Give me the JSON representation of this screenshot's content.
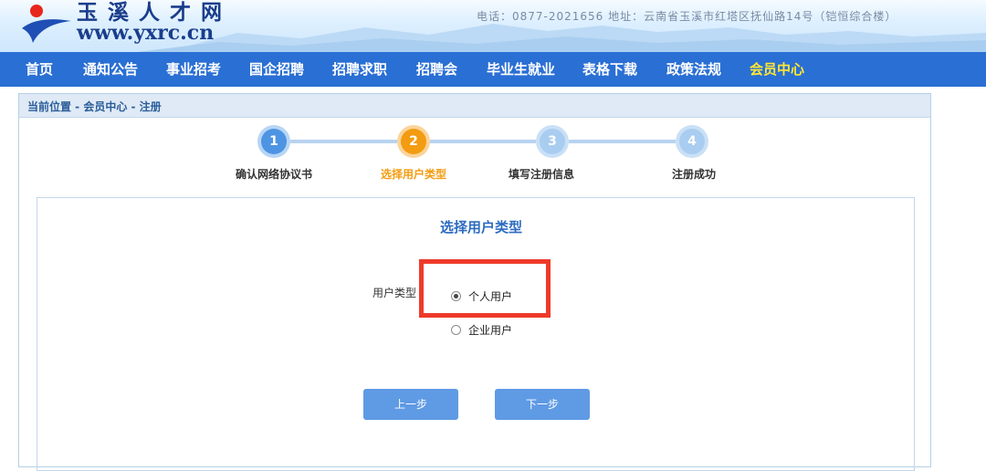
{
  "header": {
    "site_name": "玉溪人才网",
    "site_url": "www.yxrc.cn",
    "contact": "电话：0877-2021656  地址：云南省玉溪市红塔区抚仙路14号（铠恒综合楼）"
  },
  "nav": {
    "items": [
      {
        "label": "首页"
      },
      {
        "label": "通知公告"
      },
      {
        "label": "事业招考"
      },
      {
        "label": "国企招聘"
      },
      {
        "label": "招聘求职"
      },
      {
        "label": "招聘会"
      },
      {
        "label": "毕业生就业"
      },
      {
        "label": "表格下载"
      },
      {
        "label": "政策法规"
      },
      {
        "label": "会员中心"
      }
    ],
    "active": "会员中心"
  },
  "breadcrumb": "当前位置 - 会员中心 - 注册",
  "steps": [
    {
      "number": "1",
      "label": "确认网络协议书",
      "state": "done"
    },
    {
      "number": "2",
      "label": "选择用户类型",
      "state": "current"
    },
    {
      "number": "3",
      "label": "填写注册信息",
      "state": "todo"
    },
    {
      "number": "4",
      "label": "注册成功",
      "state": "todo"
    }
  ],
  "form": {
    "title": "选择用户类型",
    "field_label": "用户类型",
    "options": [
      {
        "label": "个人用户",
        "selected": true
      },
      {
        "label": "企业用户",
        "selected": false
      }
    ],
    "prev_button": "上一步",
    "next_button": "下一步"
  },
  "colors": {
    "nav_bg": "#2a6fd4",
    "nav_active": "#ffe832",
    "step_done": "#4d94e3",
    "step_current": "#f39c12",
    "step_todo": "#a9cdf0",
    "title_blue": "#2d6cc0",
    "button_bg": "#5f9ae4",
    "highlight_red": "#ee3a2a"
  }
}
